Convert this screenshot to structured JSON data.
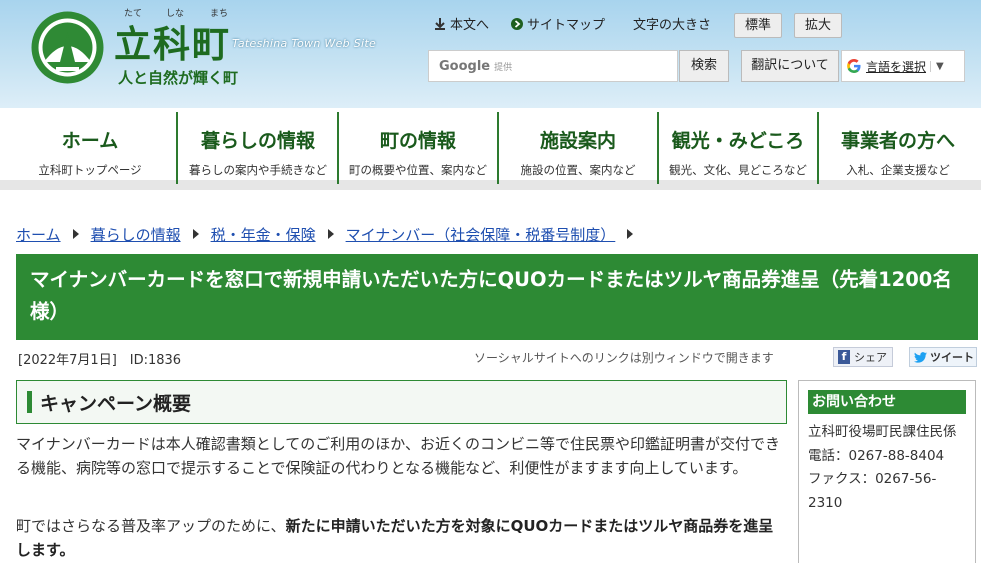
{
  "header": {
    "furigana": [
      "たて",
      "しな",
      "まち"
    ],
    "site_name": "立科町",
    "site_name_en": "Tateshina Town Web Site",
    "tagline": "人と自然が輝く町",
    "links": {
      "to_body": "本文へ",
      "sitemap": "サイトマップ",
      "font_size_label": "文字の大きさ",
      "standard": "標準",
      "enlarge": "拡大"
    },
    "search": {
      "google_word": "Google",
      "google_sub": "提供",
      "button": "検索"
    },
    "translate": {
      "button": "翻訳について",
      "select": "言語を選択"
    }
  },
  "nav": [
    {
      "title": "ホーム",
      "sub": "立科町トップページ"
    },
    {
      "title": "暮らしの情報",
      "sub": "暮らしの案内や手続きなど"
    },
    {
      "title": "町の情報",
      "sub": "町の概要や位置、案内など"
    },
    {
      "title": "施設案内",
      "sub": "施設の位置、案内など"
    },
    {
      "title": "観光・みどころ",
      "sub": "観光、文化、見どころなど"
    },
    {
      "title": "事業者の方へ",
      "sub": "入札、企業支援など"
    }
  ],
  "breadcrumb": [
    "ホーム",
    "暮らしの情報",
    "税・年金・保険",
    "マイナンバー（社会保障・税番号制度）"
  ],
  "page": {
    "title": "マイナンバーカードを窓口で新規申請いただいた方にQUOカードまたはツルヤ商品券進呈（先着1200名様）",
    "meta": "[2022年7月1日]　ID:1836",
    "social_note": "ソーシャルサイトへのリンクは別ウィンドウで開きます",
    "share_fb": "シェア",
    "share_tw": "ツイート"
  },
  "section": {
    "title": "キャンペーン概要",
    "para1": "マイナンバーカードは本人確認書類としてのご利用のほか、お近くのコンビニ等で住民票や印鑑証明書が交付できる機能、病院等の窓口で提示することで保険証の代わりとなる機能など、利便性がますます向上しています。",
    "para2_plain": "町ではさらなる普及率アップのために、",
    "para2_bold": "新たに申請いただいた方を対象にQUOカードまたはツルヤ商品券を進呈します。"
  },
  "contact": {
    "heading": "お問い合わせ",
    "office": "立科町役場町民課住民係",
    "phone": "電話：0267-88-8404",
    "fax": "ファクス：0267-56-2310"
  },
  "colors": {
    "brand_green": "#2d8a34",
    "nav_title_green": "#1a5a1c",
    "link_blue": "#1f4fb0"
  }
}
